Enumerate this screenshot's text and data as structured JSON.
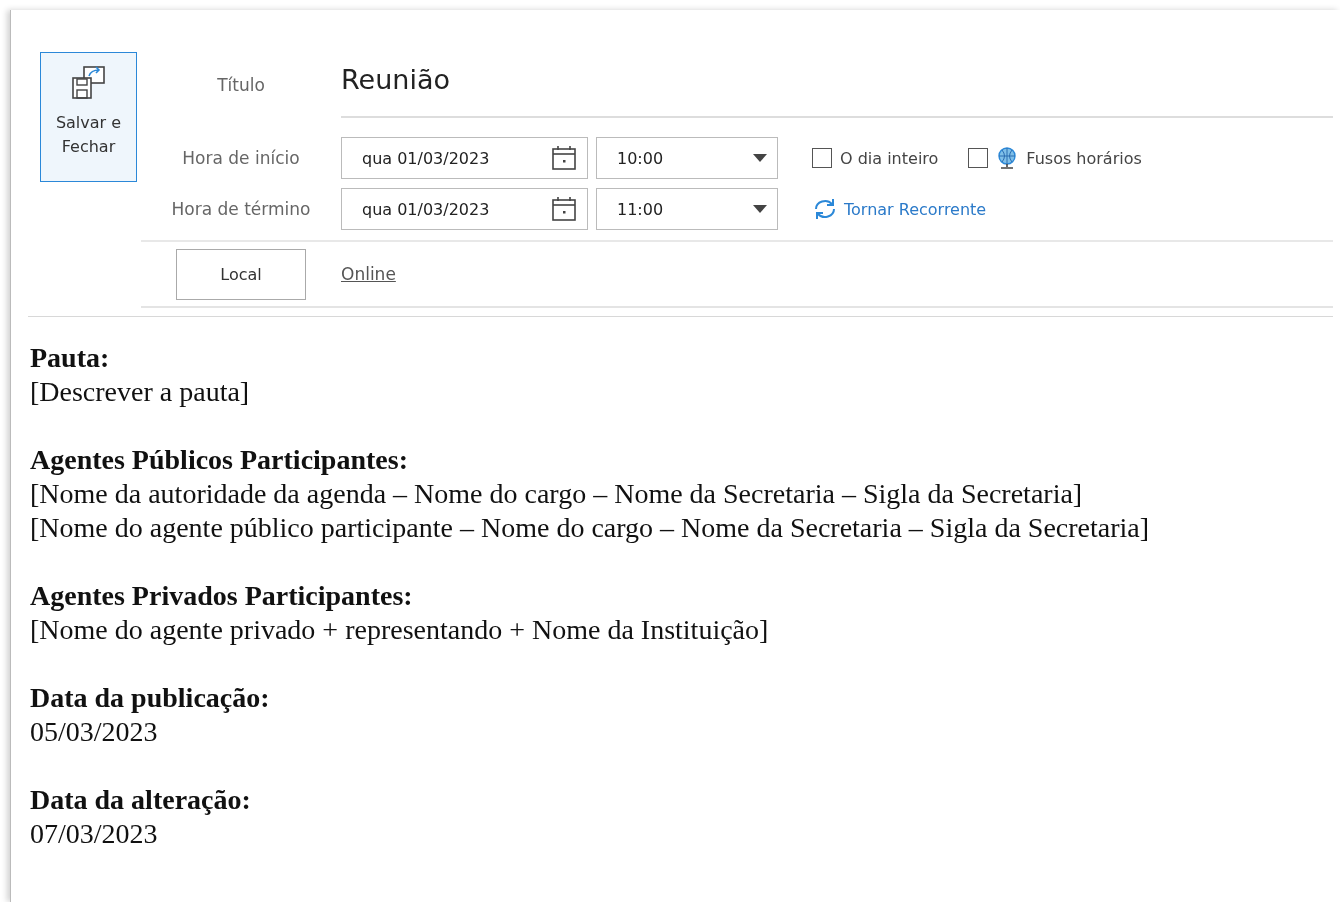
{
  "save_button": {
    "label": "Salvar e Fechar"
  },
  "form": {
    "title": {
      "label": "Título",
      "value": "Reunião"
    },
    "start": {
      "label": "Hora de início",
      "date": "qua 01/03/2023",
      "time": "10:00"
    },
    "end": {
      "label": "Hora de término",
      "date": "qua 01/03/2023",
      "time": "11:00"
    },
    "all_day": {
      "label": "O dia inteiro",
      "checked": false
    },
    "time_zones": {
      "label": "Fusos horários",
      "checked": false
    },
    "recurrence": {
      "label": "Tornar Recorrente"
    },
    "location": {
      "button": "Local",
      "value": "Online"
    }
  },
  "body": [
    {
      "heading": "Pauta:",
      "lines": [
        "[Descrever a pauta]"
      ]
    },
    {
      "heading": "Agentes Públicos Participantes:",
      "lines": [
        "[Nome da autoridade da agenda – Nome do cargo – Nome da Secretaria – Sigla da Secretaria]",
        "[Nome do agente público participante – Nome do cargo – Nome da Secretaria – Sigla da Secretaria]"
      ]
    },
    {
      "heading": "Agentes Privados Participantes:",
      "lines": [
        "[Nome do agente privado + representando + Nome da Instituição]"
      ]
    },
    {
      "heading": "Data da publicação:",
      "lines": [
        "05/03/2023"
      ]
    },
    {
      "heading": "Data da alteração:",
      "lines": [
        "07/03/2023"
      ]
    }
  ]
}
